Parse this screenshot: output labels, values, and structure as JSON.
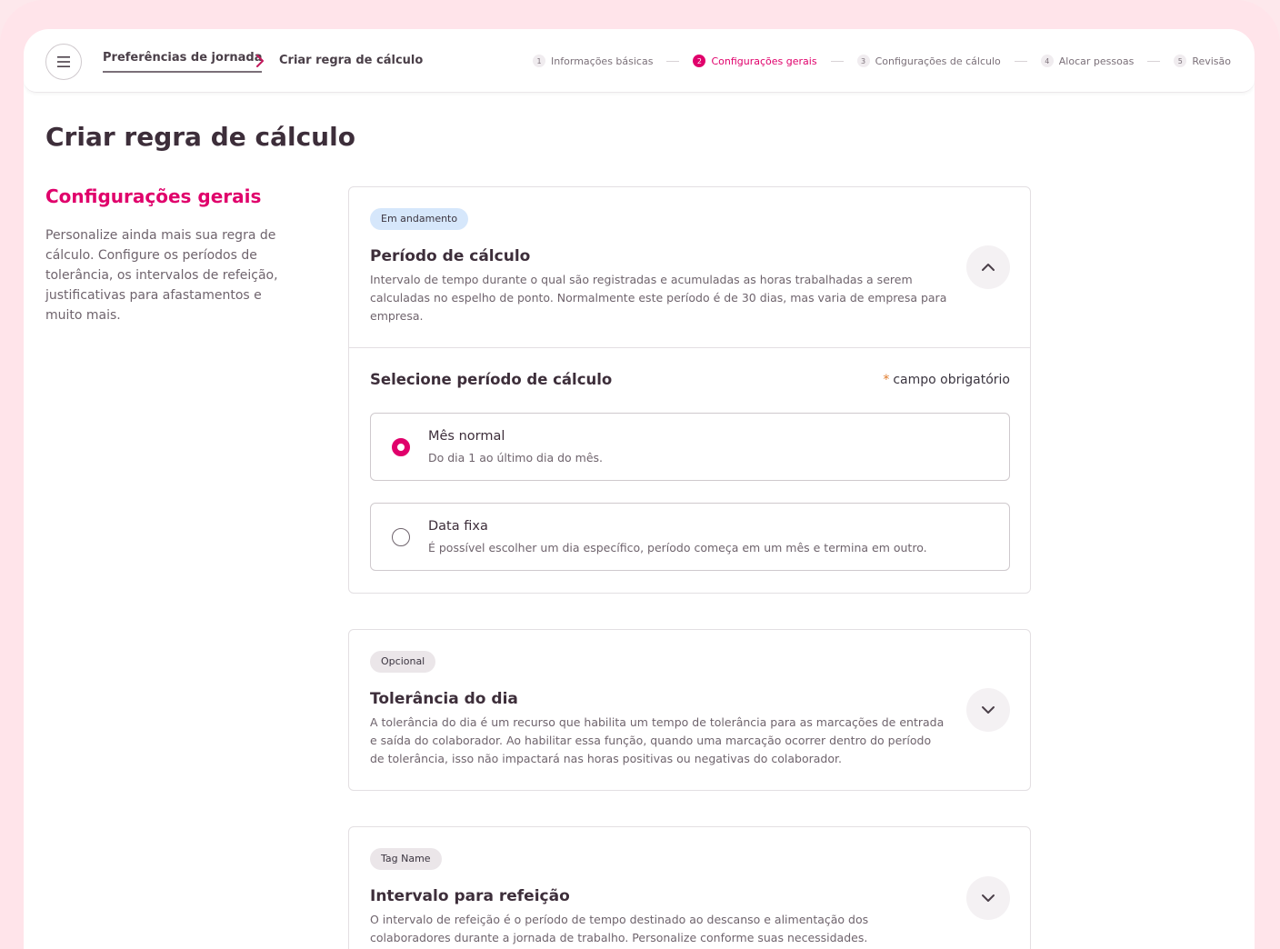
{
  "header": {
    "breadcrumb": [
      {
        "label": "Preferências de jornada"
      },
      {
        "label": "Criar regra de cálculo"
      }
    ],
    "steps": [
      {
        "num": "1",
        "label": "Informações básicas",
        "active": false
      },
      {
        "num": "2",
        "label": "Configurações gerais",
        "active": true
      },
      {
        "num": "3",
        "label": "Configurações de cálculo",
        "active": false
      },
      {
        "num": "4",
        "label": "Alocar pessoas",
        "active": false
      },
      {
        "num": "5",
        "label": "Revisão",
        "active": false
      }
    ]
  },
  "page": {
    "title": "Criar regra de cálculo",
    "section_title": "Configurações gerais",
    "section_desc": "Personalize ainda mais sua regra de cálculo. Configure os períodos de tolerância, os intervalos de refeição, justificativas para afastamentos e muito mais."
  },
  "cards": {
    "periodo": {
      "badge": "Em andamento",
      "title": "Período de cálculo",
      "desc": "Intervalo de tempo durante o qual são registradas e acumuladas as horas trabalhadas a serem calculadas no espelho de ponto. Normalmente este período é de 30 dias, mas varia de empresa para empresa.",
      "select_label": "Selecione período de cálculo",
      "required_mark": "*",
      "required_label": "campo obrigatório",
      "options": [
        {
          "title": "Mês normal",
          "desc": "Do dia 1 ao último dia do mês.",
          "checked": true
        },
        {
          "title": "Data fixa",
          "desc": "É possível escolher um dia específico,  período começa em um mês e termina em outro.",
          "checked": false
        }
      ]
    },
    "tolerancia": {
      "badge": "Opcional",
      "title": "Tolerância do dia",
      "desc": "A tolerância do dia é um recurso que habilita um tempo de tolerância para as marcações de entrada e saída do colaborador. Ao habilitar essa função, quando uma marcação ocorrer dentro do período de tolerância, isso não impactará nas horas positivas ou negativas do colaborador."
    },
    "refeicao": {
      "badge": "Tag Name",
      "title": "Intervalo para refeição",
      "desc": "O intervalo de refeição é o período de tempo destinado ao descanso e alimentação dos colaboradores durante a jornada de trabalho. Personalize conforme suas necessidades."
    }
  },
  "colors": {
    "accent": "#e0006b",
    "background": "#ffe4ea",
    "badge_in_progress": "#d6e7fb",
    "badge_neutral": "#ebe6e9"
  },
  "icons": {
    "menu": "hamburger-icon",
    "breadcrumb_separator": "chevron-right-icon",
    "collapse": "chevron-up-icon",
    "expand": "chevron-down-icon"
  }
}
